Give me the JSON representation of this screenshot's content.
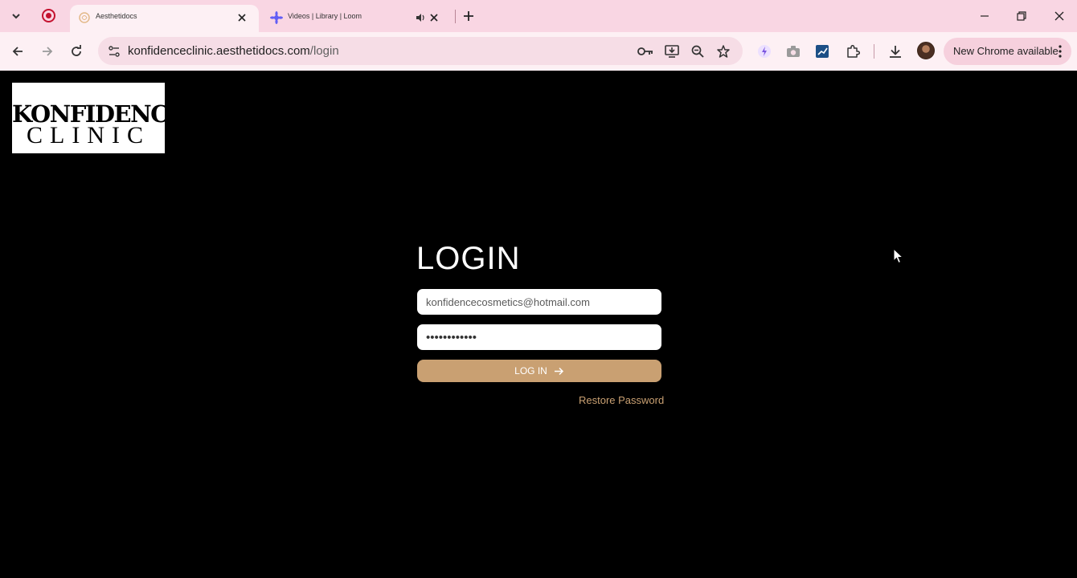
{
  "browser": {
    "tabs": [
      {
        "title": "Aesthetidocs",
        "active": true
      },
      {
        "title": "Videos | Library | Loom",
        "active": false
      }
    ],
    "address_bar": {
      "domain": "konfidenceclinic.aesthetidocs.com",
      "path": "/login"
    },
    "update_button": {
      "label": "New Chrome available"
    }
  },
  "page": {
    "logo": {
      "line1": "KONFIDENCE",
      "line2": "CLINIC"
    },
    "title": "LOGIN",
    "email_field": {
      "value": "konfidencecosmetics@hotmail.com"
    },
    "password_field": {
      "value": "••••••••••••"
    },
    "login_button": {
      "label": "LOG IN"
    },
    "restore_link": {
      "label": "Restore Password"
    }
  },
  "colors": {
    "accent": "#c9a072",
    "tabstrip": "#f9d6e3",
    "toolbar": "#fdf0f4",
    "page_bg": "#000000"
  }
}
